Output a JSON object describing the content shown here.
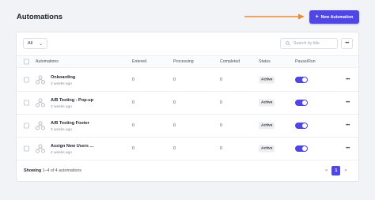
{
  "page": {
    "title": "Automations"
  },
  "header": {
    "new_button_label": "New Automation",
    "new_button_icon": "plus-icon"
  },
  "toolbar": {
    "filter_value": "All",
    "search_placeholder": "Search by title",
    "more_label": "•••"
  },
  "table": {
    "columns": [
      "Automations",
      "Entered",
      "Processing",
      "Completed",
      "Status",
      "Pause/Run"
    ],
    "rows": [
      {
        "name": "Onboarding",
        "time": "2 weeks ago",
        "entered": "0",
        "processing": "0",
        "completed": "0",
        "status": "Active",
        "running": true
      },
      {
        "name": "A/B Testing - Pop-up",
        "time": "2 weeks ago",
        "entered": "0",
        "processing": "0",
        "completed": "0",
        "status": "Active",
        "running": true
      },
      {
        "name": "A/B Testing Footer",
        "time": "2 weeks ago",
        "entered": "0",
        "processing": "0",
        "completed": "0",
        "status": "Active",
        "running": true
      },
      {
        "name": "Assign New Users ...",
        "time": "2 weeks ago",
        "entered": "0",
        "processing": "0",
        "completed": "0",
        "status": "Active",
        "running": true
      }
    ],
    "row_menu_label": "•••"
  },
  "footer": {
    "showing_label": "Showing",
    "range_text": "1–4 of 4 automations"
  },
  "pagination": {
    "prev": "«",
    "current": "1",
    "next": "»"
  },
  "colors": {
    "accent": "#4f46e5",
    "arrow": "#f08a2c"
  }
}
